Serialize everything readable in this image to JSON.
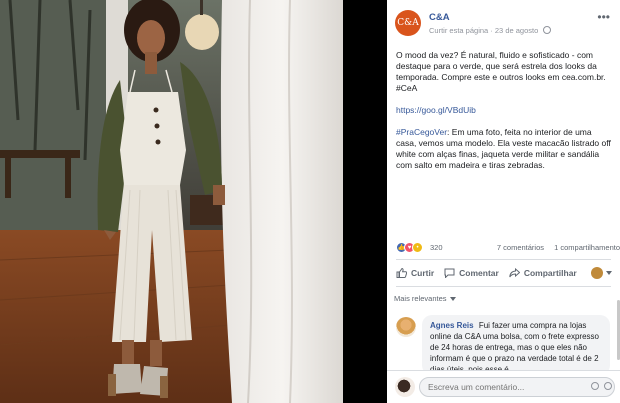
{
  "post": {
    "page_name": "C&A",
    "avatar_text": "C&A",
    "follow_link": "Curtir esta página",
    "separator": "·",
    "date": "23 de agosto",
    "text_p1": "O mood da vez? É natural, fluido e sofisticado - com destaque para o verde, que será estrela dos looks da temporada. Compre este e outros looks em cea.com.br. #CeA",
    "link": "https://goo.gl/VBdUib",
    "hashtag": "#PraCegoVer",
    "text_p3": ": Em uma foto, feita no interior de uma casa, vemos uma modelo. Ela veste macacão listrado off white com alças finas, jaqueta verde militar e sandália com salto em madeira e tiras zebradas."
  },
  "stats": {
    "reaction_count": "320",
    "comments": "7 comentários",
    "shares": "1 compartilhamento"
  },
  "actions": {
    "like": "Curtir",
    "comment": "Comentar",
    "share": "Compartilhar"
  },
  "comments_filter": "Mais relevantes",
  "comment": {
    "author": "Agnes Reis",
    "text": "Fui fazer uma compra na lojas online da C&A uma bolsa, com o frete expresso de 24 horas de entrega, mas o que eles não informam é que o prazo na verdade total é de 2 dias úteis, pois esse é"
  },
  "comment_input": {
    "placeholder": "Escreva um comentário..."
  },
  "colors": {
    "brand": "#d9541c",
    "link": "#365899",
    "like": "#4267b2"
  }
}
